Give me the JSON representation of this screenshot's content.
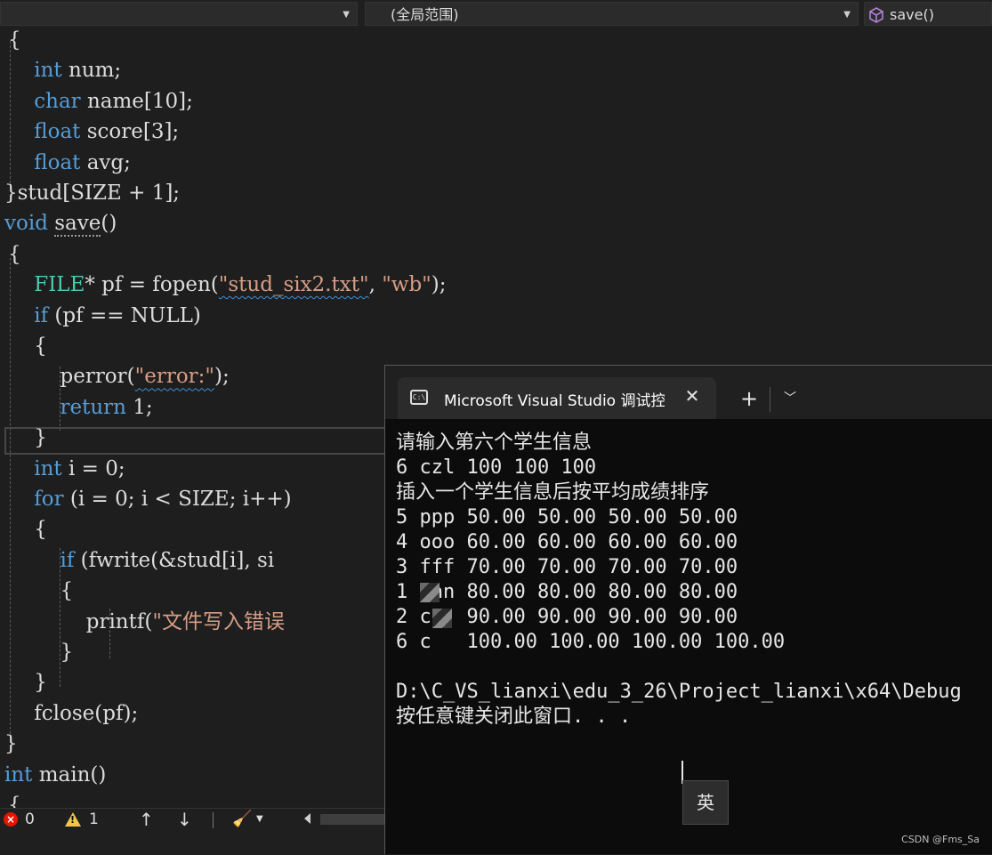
{
  "navbar": {
    "scope_combo": "(全局范围)",
    "member_combo": "save()"
  },
  "code": {
    "lines": [
      {
        "segs": [
          {
            "t": "{",
            "c": ""
          }
        ]
      },
      {
        "segs": [
          {
            "t": "    ",
            "c": ""
          },
          {
            "t": "int",
            "c": "kw"
          },
          {
            "t": " num;",
            "c": ""
          }
        ]
      },
      {
        "segs": [
          {
            "t": "    ",
            "c": ""
          },
          {
            "t": "char",
            "c": "kw"
          },
          {
            "t": " name[10];",
            "c": ""
          }
        ]
      },
      {
        "segs": [
          {
            "t": "    ",
            "c": ""
          },
          {
            "t": "float",
            "c": "kw"
          },
          {
            "t": " score[3];",
            "c": ""
          }
        ]
      },
      {
        "segs": [
          {
            "t": "    ",
            "c": ""
          },
          {
            "t": "float",
            "c": "kw"
          },
          {
            "t": " avg;",
            "c": ""
          }
        ]
      },
      {
        "segs": [
          {
            "t": "}stud[SIZE + 1];",
            "c": ""
          }
        ]
      },
      {
        "segs": [
          {
            "t": "void",
            "c": "kw"
          },
          {
            "t": " ",
            "c": ""
          },
          {
            "t": "save",
            "c": "dotted"
          },
          {
            "t": "()",
            "c": ""
          }
        ]
      },
      {
        "segs": [
          {
            "t": "{",
            "c": ""
          }
        ]
      },
      {
        "segs": [
          {
            "t": "    ",
            "c": ""
          },
          {
            "t": "FILE",
            "c": "ty"
          },
          {
            "t": "* pf = fopen(",
            "c": ""
          },
          {
            "t": "\"stud_six2.txt\"",
            "c": "str squig"
          },
          {
            "t": ", ",
            "c": ""
          },
          {
            "t": "\"wb\"",
            "c": "str"
          },
          {
            "t": ");",
            "c": ""
          }
        ]
      },
      {
        "segs": [
          {
            "t": "    ",
            "c": ""
          },
          {
            "t": "if",
            "c": "kw"
          },
          {
            "t": " (pf == NULL)",
            "c": ""
          }
        ]
      },
      {
        "segs": [
          {
            "t": "    {",
            "c": ""
          }
        ]
      },
      {
        "segs": [
          {
            "t": "        perror(",
            "c": ""
          },
          {
            "t": "\"error:\"",
            "c": "str squig"
          },
          {
            "t": ");",
            "c": ""
          }
        ]
      },
      {
        "segs": [
          {
            "t": "        ",
            "c": ""
          },
          {
            "t": "return",
            "c": "kw"
          },
          {
            "t": " 1;",
            "c": ""
          }
        ]
      },
      {
        "segs": [
          {
            "t": "    }",
            "c": ""
          }
        ]
      },
      {
        "segs": [
          {
            "t": "    ",
            "c": ""
          },
          {
            "t": "int",
            "c": "kw"
          },
          {
            "t": " i = 0;",
            "c": ""
          }
        ]
      },
      {
        "segs": [
          {
            "t": "    ",
            "c": ""
          },
          {
            "t": "for",
            "c": "kw"
          },
          {
            "t": " (i = 0; i < SIZE; i++)",
            "c": ""
          }
        ]
      },
      {
        "segs": [
          {
            "t": "    {",
            "c": ""
          }
        ]
      },
      {
        "segs": [
          {
            "t": "        ",
            "c": ""
          },
          {
            "t": "if",
            "c": "kw"
          },
          {
            "t": " (fwrite(&stud[i], si",
            "c": ""
          }
        ]
      },
      {
        "segs": [
          {
            "t": "        {",
            "c": ""
          }
        ]
      },
      {
        "segs": [
          {
            "t": "            printf(",
            "c": ""
          },
          {
            "t": "\"文件写入错误",
            "c": "str"
          }
        ]
      },
      {
        "segs": [
          {
            "t": "        }",
            "c": ""
          }
        ]
      },
      {
        "segs": [
          {
            "t": "    }",
            "c": ""
          }
        ]
      },
      {
        "segs": [
          {
            "t": "    fclose(pf);",
            "c": ""
          }
        ]
      },
      {
        "segs": [
          {
            "t": "}",
            "c": ""
          }
        ]
      },
      {
        "segs": [
          {
            "t": "int",
            "c": "kw"
          },
          {
            "t": " main()",
            "c": ""
          }
        ]
      },
      {
        "segs": [
          {
            "t": "{",
            "c": ""
          }
        ]
      }
    ]
  },
  "status": {
    "errors": "0",
    "warnings": "1"
  },
  "terminal": {
    "tab_title": "Microsoft Visual Studio 调试控制台",
    "lines": [
      "请输入第六个学生信息",
      "6 czl 100 100 100",
      "插入一个学生信息后按平均成绩排序",
      "5 ppp 50.00 50.00 50.00 50.00",
      "4 ooo 60.00 60.00 60.00 60.00",
      "3 fff 70.00 70.00 70.00 70.00",
      "1 fan 80.00 80.00 80.00 80.00",
      "2 cc  90.00 90.00 90.00 90.00",
      "6 c   100.00 100.00 100.00 100.00",
      "",
      "D:\\C_VS_lianxi\\edu_3_26\\Project_lianxi\\x64\\Debug",
      "按任意键关闭此窗口. . ."
    ],
    "ime_indicator": "英"
  },
  "watermark": "CSDN @Fms_Sa"
}
